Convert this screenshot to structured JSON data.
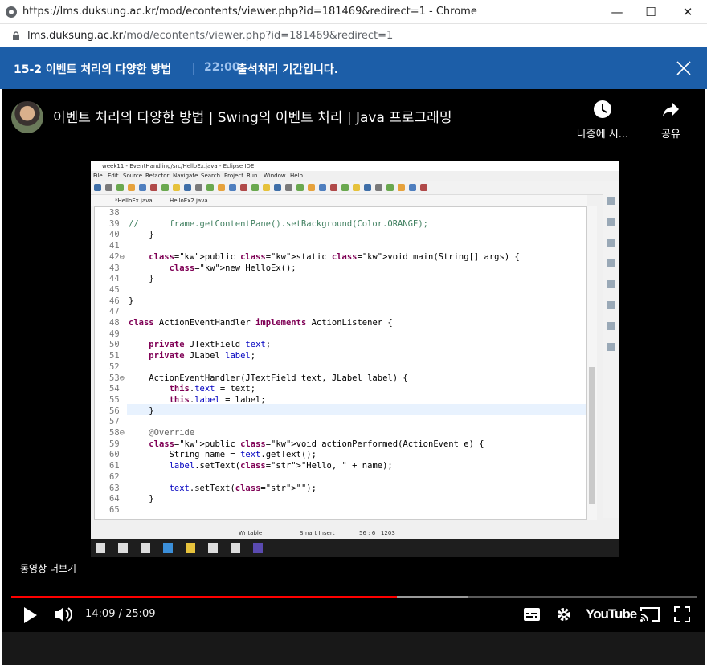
{
  "browser": {
    "title": "https://lms.duksung.ac.kr/mod/econtents/viewer.php?id=181469&redirect=1 - Chrome",
    "url_host": "lms.duksung.ac.kr",
    "url_path": "/mod/econtents/viewer.php?id=181469&redirect=1"
  },
  "notice": {
    "lesson": "15-2 이벤트 처리의 다양한 방법",
    "time": "22:00",
    "message": "출석처리 기간입니다."
  },
  "video": {
    "title": "이벤트 처리의 다양한 방법 | Swing의 이벤트 처리 | Java 프로그래밍",
    "watch_later": "나중에 시...",
    "share": "공유",
    "more_videos": "동영상 더보기",
    "time": "14:09 / 25:09",
    "progress": 0.5625,
    "buffered": 0.666,
    "logo": "YouTube"
  },
  "eclipse": {
    "window_title": "week11 - EventHandling/src/HelloEx.java - Eclipse IDE",
    "menu": [
      "File",
      "Edit",
      "Source",
      "Refactor",
      "Navigate",
      "Search",
      "Project",
      "Run",
      "Window",
      "Help"
    ],
    "tabs": [
      "*HelloEx.java",
      "HelloEx2.java"
    ],
    "status": {
      "mode": "Writable",
      "insert": "Smart Insert",
      "position": "56 : 6 : 1203"
    },
    "lines": [
      {
        "n": "38",
        "code": ""
      },
      {
        "n": "39",
        "code": "//      frame.getContentPane().setBackground(Color.ORANGE);"
      },
      {
        "n": "40",
        "code": "    }"
      },
      {
        "n": "41",
        "code": ""
      },
      {
        "n": "42⊖",
        "code": "    public static void main(String[] args) {"
      },
      {
        "n": "43",
        "code": "        new HelloEx();"
      },
      {
        "n": "44",
        "code": "    }"
      },
      {
        "n": "45",
        "code": ""
      },
      {
        "n": "46",
        "code": "}"
      },
      {
        "n": "47",
        "code": ""
      },
      {
        "n": "48",
        "code": "class ActionEventHandler implements ActionListener {"
      },
      {
        "n": "49",
        "code": ""
      },
      {
        "n": "50",
        "code": "    private JTextField text;"
      },
      {
        "n": "51",
        "code": "    private JLabel label;"
      },
      {
        "n": "52",
        "code": ""
      },
      {
        "n": "53⊖",
        "code": "    ActionEventHandler(JTextField text, JLabel label) {"
      },
      {
        "n": "54",
        "code": "        this.text = text;"
      },
      {
        "n": "55",
        "code": "        this.label = label;"
      },
      {
        "n": "56",
        "code": "    }"
      },
      {
        "n": "57",
        "code": ""
      },
      {
        "n": "58⊖",
        "code": "    @Override"
      },
      {
        "n": "59",
        "code": "    public void actionPerformed(ActionEvent e) {"
      },
      {
        "n": "60",
        "code": "        String name = text.getText();"
      },
      {
        "n": "61",
        "code": "        label.setText(\"Hello, \" + name);"
      },
      {
        "n": "62",
        "code": ""
      },
      {
        "n": "63",
        "code": "        text.setText(\"\");"
      },
      {
        "n": "64",
        "code": "    }"
      },
      {
        "n": "65",
        "code": ""
      }
    ]
  }
}
